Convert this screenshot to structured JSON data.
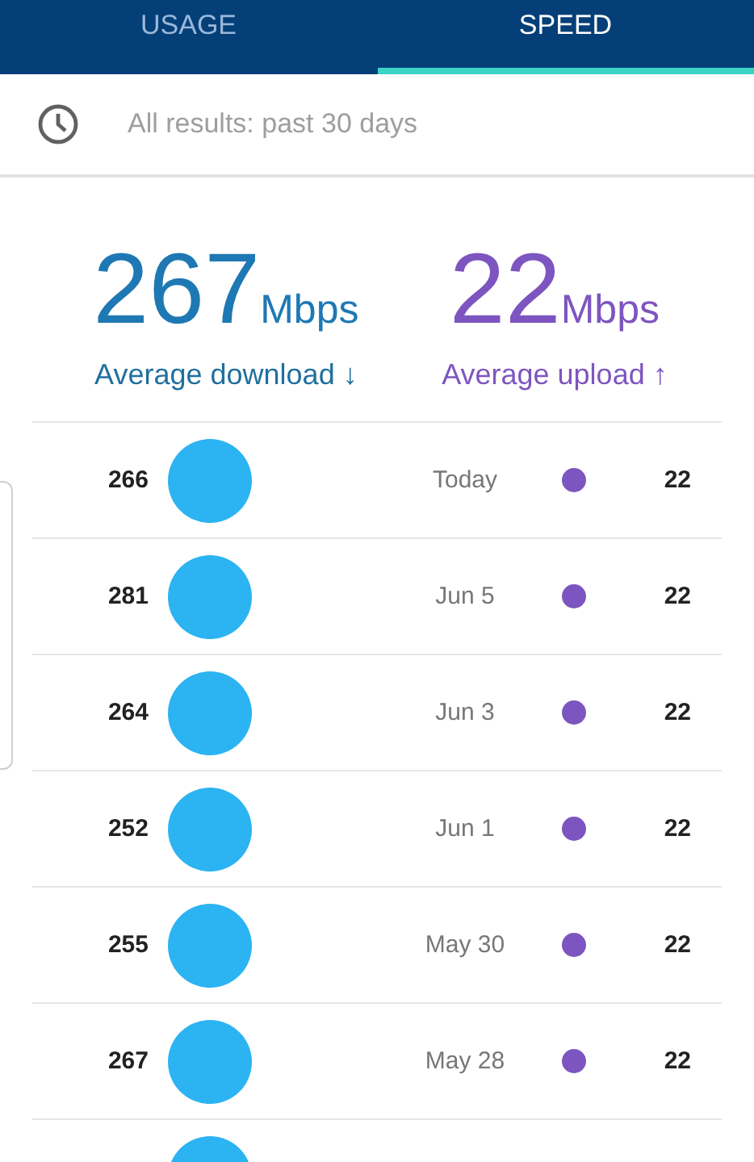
{
  "tabs": [
    {
      "label": "USAGE",
      "selected": false
    },
    {
      "label": "SPEED",
      "selected": true
    }
  ],
  "filter": {
    "text": "All results: past 30 days"
  },
  "summary": {
    "download": {
      "value": "267",
      "unit": "Mbps",
      "label": "Average download ↓"
    },
    "upload": {
      "value": "22",
      "unit": "Mbps",
      "label": "Average upload ↑"
    }
  },
  "results": [
    {
      "download": "266",
      "date": "Today",
      "upload": "22"
    },
    {
      "download": "281",
      "date": "Jun 5",
      "upload": "22"
    },
    {
      "download": "264",
      "date": "Jun 3",
      "upload": "22"
    },
    {
      "download": "252",
      "date": "Jun 1",
      "upload": "22"
    },
    {
      "download": "255",
      "date": "May 30",
      "upload": "22"
    },
    {
      "download": "267",
      "date": "May 28",
      "upload": "22"
    }
  ]
}
